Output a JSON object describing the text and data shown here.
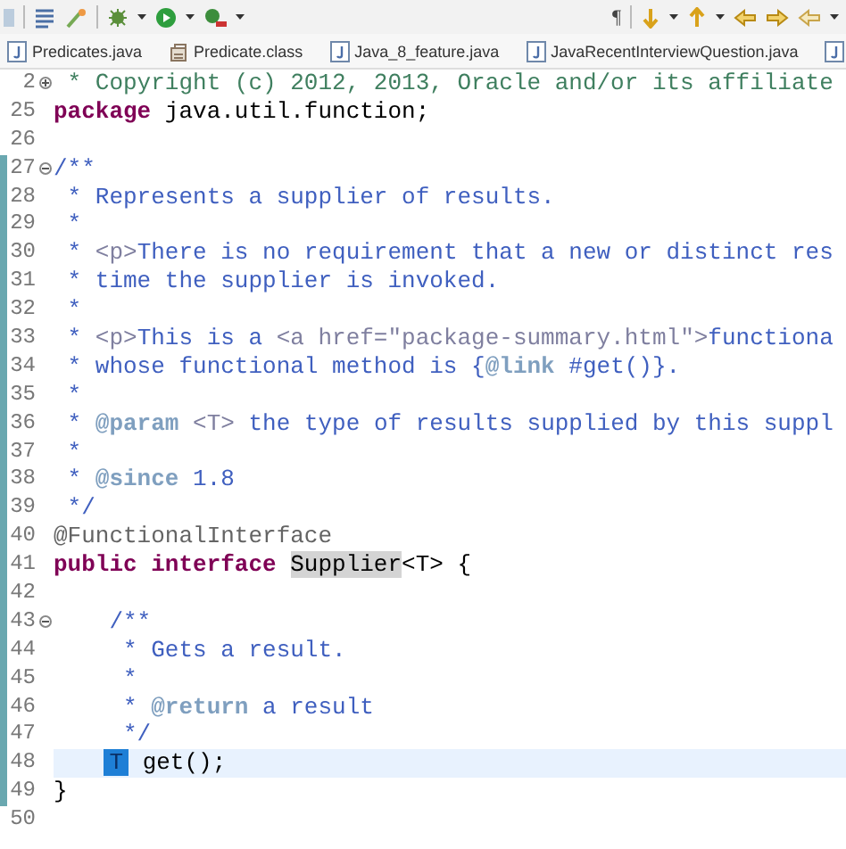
{
  "toolbar": {
    "whitespace_toggle": "¶"
  },
  "tabs": [
    {
      "kind": "java",
      "label": "Predicates.java"
    },
    {
      "kind": "class",
      "label": "Predicate.class"
    },
    {
      "kind": "java",
      "label": "Java_8_feature.java"
    },
    {
      "kind": "java",
      "label": "JavaRecentInterviewQuestion.java"
    },
    {
      "kind": "java"
    }
  ],
  "editor": {
    "lines": [
      {
        "number": "2",
        "collapsed": true,
        "changed": false,
        "current": false,
        "tokens": [
          {
            "kind": "comment",
            "text": " * Copyright (c) 2012, 2013, Oracle and/or its affiliate"
          }
        ]
      },
      {
        "number": "25",
        "changed": false,
        "current": false,
        "tokens": [
          {
            "kind": "keyword",
            "text": "package"
          },
          {
            "kind": "plain",
            "text": " java.util.function;"
          }
        ]
      },
      {
        "number": "26",
        "changed": false,
        "current": false
      },
      {
        "number": "27",
        "collapsed": false,
        "changed": true,
        "current": false,
        "tokens": [
          {
            "kind": "doc",
            "text": "/**"
          }
        ]
      },
      {
        "number": "28",
        "changed": true,
        "current": false,
        "tokens": [
          {
            "kind": "doc",
            "text": " * Represents a supplier of results."
          }
        ]
      },
      {
        "number": "29",
        "changed": true,
        "current": false,
        "tokens": [
          {
            "kind": "doc",
            "text": " *"
          }
        ]
      },
      {
        "number": "30",
        "changed": true,
        "current": false,
        "tokens": [
          {
            "kind": "doc",
            "text": " * "
          },
          {
            "kind": "doc-html",
            "text": "<p>"
          },
          {
            "kind": "doc",
            "text": "There is no requirement that a new or distinct res"
          }
        ]
      },
      {
        "number": "31",
        "changed": true,
        "current": false,
        "tokens": [
          {
            "kind": "doc",
            "text": " * time the supplier is invoked."
          }
        ]
      },
      {
        "number": "32",
        "changed": true,
        "current": false,
        "tokens": [
          {
            "kind": "doc",
            "text": " *"
          }
        ]
      },
      {
        "number": "33",
        "changed": true,
        "current": false,
        "tokens": [
          {
            "kind": "doc",
            "text": " * "
          },
          {
            "kind": "doc-html",
            "text": "<p>"
          },
          {
            "kind": "doc",
            "text": "This is a "
          },
          {
            "kind": "doc-html",
            "text": "<a href=\"package-summary.html\">"
          },
          {
            "kind": "doc",
            "text": "functiona"
          }
        ]
      },
      {
        "number": "34",
        "changed": true,
        "current": false,
        "tokens": [
          {
            "kind": "doc",
            "text": " * whose functional method is {"
          },
          {
            "kind": "doc-tag",
            "text": "@link"
          },
          {
            "kind": "doc",
            "text": " #get()}."
          }
        ]
      },
      {
        "number": "35",
        "changed": true,
        "current": false,
        "tokens": [
          {
            "kind": "doc",
            "text": " *"
          }
        ]
      },
      {
        "number": "36",
        "changed": true,
        "current": false,
        "tokens": [
          {
            "kind": "doc",
            "text": " * "
          },
          {
            "kind": "doc-tag",
            "text": "@param"
          },
          {
            "kind": "doc-html",
            "text": " <T>"
          },
          {
            "kind": "doc",
            "text": " the type of results supplied by this suppl"
          }
        ]
      },
      {
        "number": "37",
        "changed": true,
        "current": false,
        "tokens": [
          {
            "kind": "doc",
            "text": " *"
          }
        ]
      },
      {
        "number": "38",
        "changed": true,
        "current": false,
        "tokens": [
          {
            "kind": "doc",
            "text": " * "
          },
          {
            "kind": "doc-tag",
            "text": "@since"
          },
          {
            "kind": "doc",
            "text": " 1.8"
          }
        ]
      },
      {
        "number": "39",
        "changed": true,
        "current": false,
        "tokens": [
          {
            "kind": "doc",
            "text": " */"
          }
        ]
      },
      {
        "number": "40",
        "changed": true,
        "current": false,
        "tokens": [
          {
            "kind": "annotation",
            "text": "@FunctionalInterface"
          }
        ]
      },
      {
        "number": "41",
        "changed": true,
        "current": false,
        "tokens": [
          {
            "kind": "keyword",
            "text": "public interface "
          },
          {
            "kind": "occurrence",
            "text": "Supplier"
          },
          {
            "kind": "plain",
            "text": "<T> {"
          }
        ]
      },
      {
        "number": "42",
        "changed": true,
        "current": false
      },
      {
        "number": "43",
        "collapsed": false,
        "changed": true,
        "current": false,
        "tokens": [
          {
            "kind": "doc",
            "text": "    /**"
          }
        ]
      },
      {
        "number": "44",
        "changed": true,
        "current": false,
        "tokens": [
          {
            "kind": "doc",
            "text": "     * Gets a result."
          }
        ]
      },
      {
        "number": "45",
        "changed": true,
        "current": false,
        "tokens": [
          {
            "kind": "doc",
            "text": "     *"
          }
        ]
      },
      {
        "number": "46",
        "changed": true,
        "current": false,
        "tokens": [
          {
            "kind": "doc",
            "text": "     * "
          },
          {
            "kind": "doc-tag",
            "text": "@return"
          },
          {
            "kind": "doc",
            "text": " a result"
          }
        ]
      },
      {
        "number": "47",
        "changed": true,
        "current": false,
        "tokens": [
          {
            "kind": "doc",
            "text": "     */"
          }
        ]
      },
      {
        "number": "48",
        "changed": true,
        "current": true,
        "indented": true,
        "tokens": [
          {
            "kind": "selection",
            "text": "T"
          },
          {
            "kind": "plain",
            "text": " get();"
          }
        ]
      },
      {
        "number": "49",
        "changed": true,
        "current": false,
        "tokens": [
          {
            "kind": "plain",
            "text": "}"
          }
        ]
      },
      {
        "number": "50",
        "changed": false,
        "current": false
      }
    ]
  }
}
